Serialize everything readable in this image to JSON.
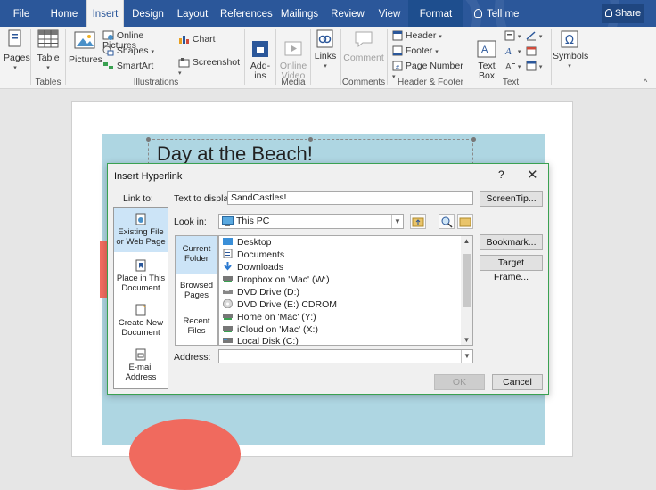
{
  "ribbon": {
    "tabs": [
      "File",
      "Home",
      "Insert",
      "Design",
      "Layout",
      "References",
      "Mailings",
      "Review",
      "View",
      "Format"
    ],
    "active_tab": "Insert",
    "tell_me": "Tell me",
    "share": "Share",
    "buttons": {
      "pages": "Pages",
      "table": "Table",
      "pictures": "Pictures",
      "online_pictures": "Online Pictures",
      "shapes": "Shapes",
      "smartart": "SmartArt",
      "chart": "Chart",
      "screenshot": "Screenshot",
      "addins": "Add-\nins",
      "online_video": "Online\nVideo",
      "links": "Links",
      "comment": "Comment",
      "header": "Header",
      "footer": "Footer",
      "page_number": "Page Number",
      "text_box": "Text\nBox",
      "symbols": "Symbols"
    },
    "groups": [
      "Tables",
      "Illustrations",
      "Media",
      "Comments",
      "Header & Footer",
      "Text"
    ]
  },
  "document": {
    "title_text": "Day at the Beach!"
  },
  "dialog": {
    "title": "Insert Hyperlink",
    "help": "?",
    "link_to_label": "Link to:",
    "text_to_display_label": "Text to display:",
    "text_to_display_value": "SandCastles!",
    "screentip_button": "ScreenTip...",
    "look_in_label": "Look in:",
    "look_in_value": "This PC",
    "link_options": [
      "Existing File\nor Web Page",
      "Place in This\nDocument",
      "Create New\nDocument",
      "E-mail\nAddress"
    ],
    "side_nav": [
      "Current\nFolder",
      "Browsed\nPages",
      "Recent\nFiles"
    ],
    "files": [
      "Desktop",
      "Documents",
      "Downloads",
      "Dropbox on 'Mac' (W:)",
      "DVD Drive (D:)",
      "DVD Drive (E:) CDROM",
      "Home on 'Mac' (Y:)",
      "iCloud on 'Mac' (X:)",
      "Local Disk (C:)"
    ],
    "bookmark_button": "Bookmark...",
    "target_frame_button": "Target Frame...",
    "address_label": "Address:",
    "address_value": "",
    "ok_button": "OK",
    "cancel_button": "Cancel"
  },
  "colors": {
    "ribbon_blue": "#2b579a",
    "banner": "#aed6e2",
    "coral": "#f26c5f",
    "dialog_border": "#3aa151",
    "selection": "#cce4f7"
  }
}
